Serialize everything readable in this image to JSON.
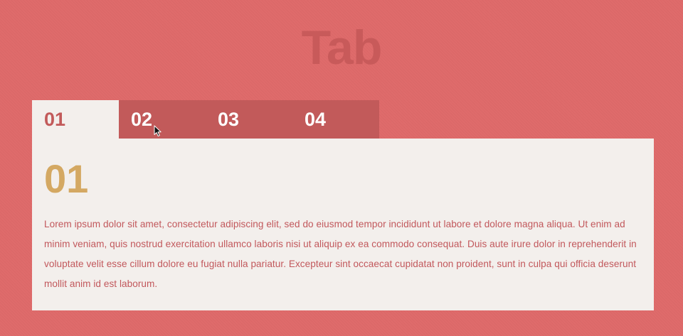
{
  "header": {
    "title": "Tab"
  },
  "tabs": [
    {
      "label": "01",
      "active": true
    },
    {
      "label": "02",
      "active": false
    },
    {
      "label": "03",
      "active": false
    },
    {
      "label": "04",
      "active": false
    }
  ],
  "panel": {
    "number": "01",
    "text": "Lorem ipsum dolor sit amet, consectetur adipiscing elit, sed do eiusmod tempor incididunt ut labore et dolore magna aliqua. Ut enim ad minim veniam, quis nostrud exercitation ullamco laboris nisi ut aliquip ex ea commodo consequat. Duis aute irure dolor in reprehenderit in voluptate velit esse cillum dolore eu fugiat nulla pariatur. Excepteur sint occaecat cupidatat non proident, sunt in culpa qui officia deserunt mollit anim id est laborum."
  },
  "colors": {
    "background": "#df6b6b",
    "tab_inactive": "#c25a5a",
    "panel_background": "#f3efec",
    "panel_number": "#d4a862",
    "panel_text": "#c2585c"
  },
  "icons": {
    "cursor": "mouse-pointer-icon"
  }
}
